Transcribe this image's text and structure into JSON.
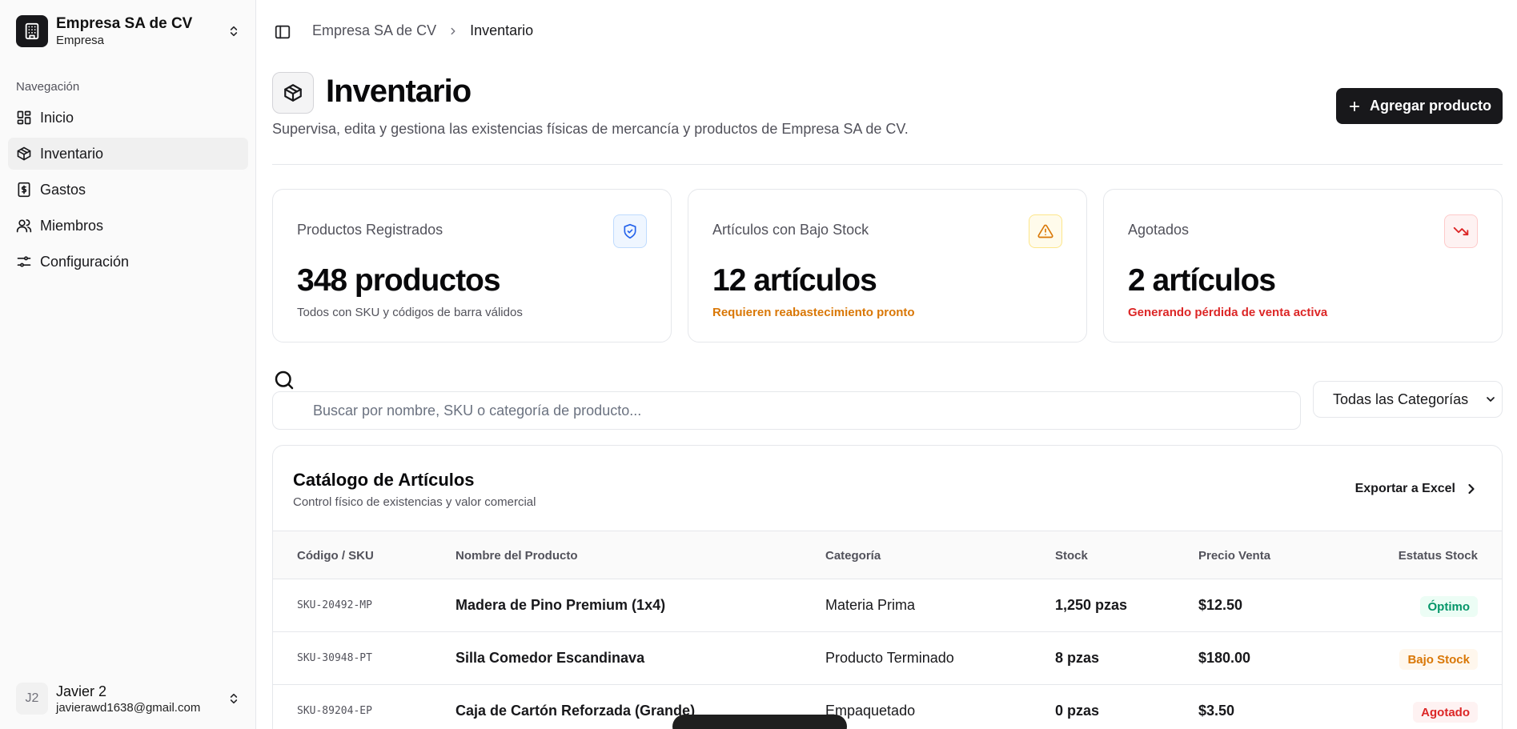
{
  "sidebar": {
    "org_name": "Empresa SA de CV",
    "org_type": "Empresa",
    "nav_label": "Navegación",
    "items": [
      {
        "label": "Inicio",
        "icon": "dashboard-icon"
      },
      {
        "label": "Inventario",
        "icon": "package-icon",
        "active": true
      },
      {
        "label": "Gastos",
        "icon": "receipt-icon"
      },
      {
        "label": "Miembros",
        "icon": "users-icon"
      },
      {
        "label": "Configuración",
        "icon": "settings-sliders-icon"
      }
    ],
    "user": {
      "initials": "J2",
      "name": "Javier 2",
      "email": "javierawd1638@gmail.com"
    }
  },
  "breadcrumb": {
    "parent": "Empresa SA de CV",
    "current": "Inventario"
  },
  "header": {
    "title": "Inventario",
    "subtitle": "Supervisa, edita y gestiona las existencias físicas de mercancía y productos de Empresa SA de CV.",
    "add_button": "Agregar producto"
  },
  "stats": [
    {
      "label": "Productos Registrados",
      "value": "348 productos",
      "note": "Todos con SKU y códigos de barra válidos",
      "icon": "shield-check-icon",
      "accent": "#2563eb",
      "bg": "#eff6ff",
      "border": "#bfdbfe",
      "note_color": "#52525b"
    },
    {
      "label": "Artículos con Bajo Stock",
      "value": "12 artículos",
      "note": "Requieren reabastecimiento pronto",
      "icon": "warning-icon",
      "accent": "#d97706",
      "bg": "#fffbeb",
      "border": "#fde68a",
      "note_color": "#d97706"
    },
    {
      "label": "Agotados",
      "value": "2 artículos",
      "note": "Generando pérdida de venta activa",
      "icon": "trending-down-icon",
      "accent": "#dc2626",
      "bg": "#fef2f2",
      "border": "#fecaca",
      "note_color": "#dc2626"
    }
  ],
  "search": {
    "placeholder": "Buscar por nombre, SKU o categoría de producto...",
    "value": ""
  },
  "filter": {
    "selected": "Todas las Categorías"
  },
  "catalog": {
    "title": "Catálogo de Artículos",
    "subtitle": "Control físico de existencias y valor comercial",
    "export_label": "Exportar a Excel",
    "columns": [
      "Código / SKU",
      "Nombre del Producto",
      "Categoría",
      "Stock",
      "Precio Venta",
      "Estatus Stock"
    ],
    "rows": [
      {
        "sku": "SKU-20492-MP",
        "name": "Madera de Pino Premium (1x4)",
        "category": "Materia Prima",
        "stock": "1,250 pzas",
        "price": "$12.50",
        "status": "Óptimo",
        "status_color": "#059669",
        "status_bg": "#ecfdf5"
      },
      {
        "sku": "SKU-30948-PT",
        "name": "Silla Comedor Escandinava",
        "category": "Producto Terminado",
        "stock": "8 pzas",
        "price": "$180.00",
        "status": "Bajo Stock",
        "status_color": "#d97706",
        "status_bg": "#fff7ed"
      },
      {
        "sku": "SKU-89204-EP",
        "name": "Caja de Cartón Reforzada (Grande)",
        "category": "Empaquetado",
        "stock": "0 pzas",
        "price": "$3.50",
        "status": "Agotado",
        "status_color": "#dc2626",
        "status_bg": "#fef2f2"
      }
    ]
  }
}
